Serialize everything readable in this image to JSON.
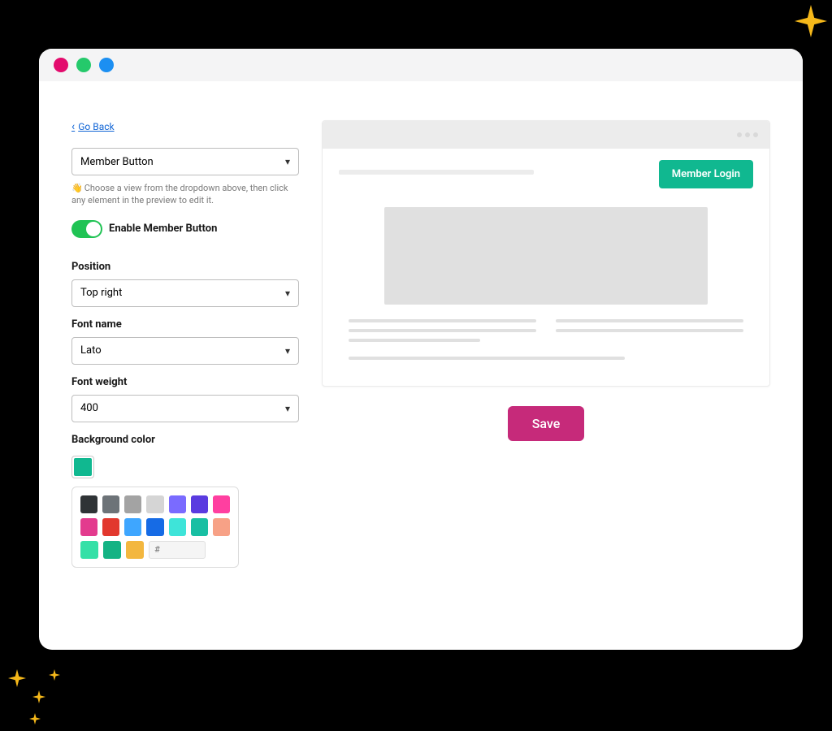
{
  "nav": {
    "go_back": "Go Back"
  },
  "view_selector": {
    "value": "Member Button"
  },
  "helper": {
    "emoji": "👋",
    "text": "Choose a view from the dropdown above, then click any element in the preview to edit it."
  },
  "toggle": {
    "label": "Enable Member Button",
    "enabled": true
  },
  "fields": {
    "position": {
      "label": "Position",
      "value": "Top right"
    },
    "font_name": {
      "label": "Font name",
      "value": "Lato"
    },
    "font_weight": {
      "label": "Font weight",
      "value": "400"
    },
    "bg_color": {
      "label": "Background color",
      "selected": "#10b890"
    }
  },
  "palette": {
    "rows": [
      [
        "#2f3336",
        "#6d7378",
        "#a3a3a3",
        "#d5d5d5",
        "#7a6bff",
        "#5a3be0",
        "#ff3fa0"
      ],
      [
        "#e33b8e",
        "#e2382e",
        "#3ea6ff",
        "#166be5",
        "#3ee4d9",
        "#18bfa3",
        "#f7a186"
      ],
      [
        "#35e0a7",
        "#14b384",
        "#f3b73f"
      ]
    ],
    "hex_placeholder": "#"
  },
  "preview": {
    "member_button": "Member Login"
  },
  "actions": {
    "save": "Save"
  },
  "colors": {
    "accent_green": "#10b890",
    "accent_pink": "#c62a7a"
  }
}
